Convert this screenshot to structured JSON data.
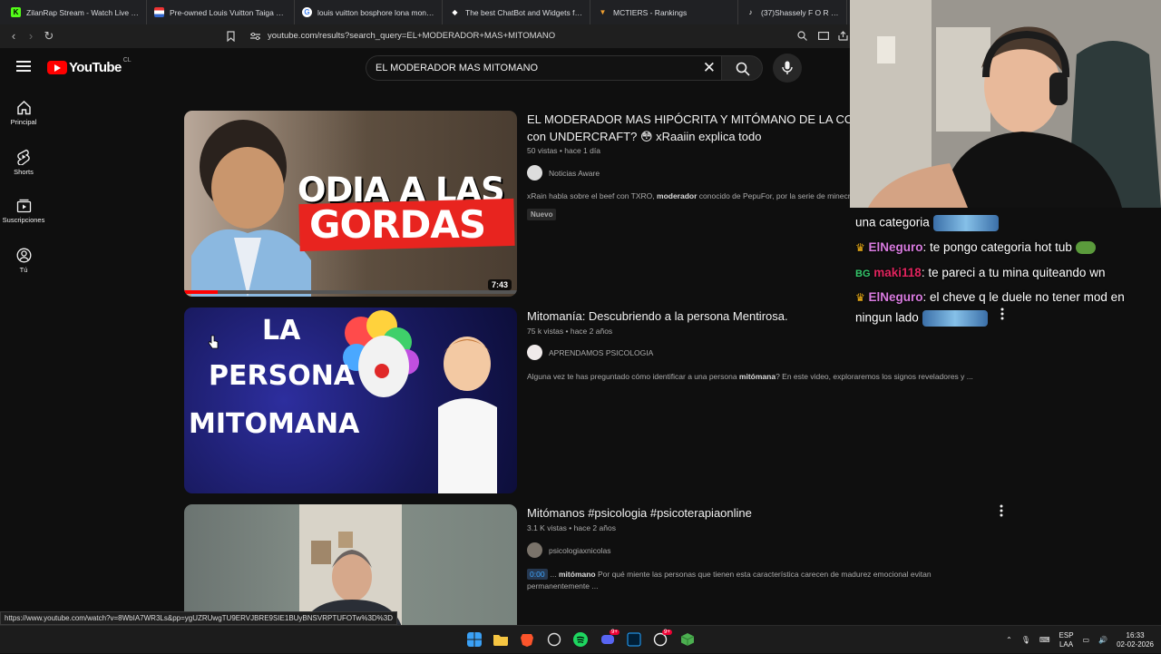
{
  "browser": {
    "tabs": [
      {
        "title": "ZilanRap Stream - Watch Live on Kick",
        "icon": "kick-icon",
        "color": "#53fc18"
      },
      {
        "title": "Pre-owned Louis Vuitton Taiga Stripe",
        "icon": "store-icon",
        "color": "#888888"
      },
      {
        "title": "louis vuitton bosphore lona monogram",
        "icon": "google-icon",
        "color": "#ffffff"
      },
      {
        "title": "The best ChatBot and Widgets for Kick",
        "icon": "chatbot-icon",
        "color": "#ffffff"
      },
      {
        "title": "MCTIERS - Rankings",
        "icon": "mctiers-icon",
        "color": "#f0a030"
      },
      {
        "title": "(37)Shassely F O R E V E R @",
        "icon": "tiktok-icon",
        "color": "#ffffff"
      }
    ],
    "url": "youtube.com/results?search_query=EL+MODERADOR+MAS+MITOMANO",
    "status_url": "https://www.youtube.com/watch?v=8WbIA7WR3Ls&pp=ygUZRUwgTU9ERVJBRE9SIE1BUyBNSVRPTUFOTw%3D%3D"
  },
  "youtube": {
    "logo_text": "YouTube",
    "country_code": "CL",
    "search_query": "EL MODERADOR MAS MITOMANO",
    "sidebar": [
      {
        "label": "Principal",
        "icon": "home-icon"
      },
      {
        "label": "Shorts",
        "icon": "shorts-icon"
      },
      {
        "label": "Suscripciones",
        "icon": "subscriptions-icon"
      },
      {
        "label": "Tú",
        "icon": "user-icon"
      }
    ],
    "results": [
      {
        "title_line1": "EL MODERADOR MAS HIPÓCRITA Y MITÓMANO DE LA COMU",
        "title_line2": "con UNDERCRAFT? 😳 xRaaiin explica todo",
        "meta": "50 vistas • hace 1 día",
        "channel": "Noticias Aware",
        "description_pre": "xRain habla sobre el beef con TXRO, ",
        "description_bold": "moderador",
        "description_post": " conocido de PepuFor, por la serie de minecr",
        "badge": "Nuevo",
        "duration": "7:43",
        "thumb_line1": "ODIA A LAS",
        "thumb_line2": "GORDAS"
      },
      {
        "title": "Mitomanía: Descubriendo a la persona Mentirosa.",
        "meta": "75 k vistas • hace 2 años",
        "channel": "APRENDAMOS PSICOLOGIA",
        "description_pre": "Alguna vez te has preguntado cómo identificar a una persona ",
        "description_bold": "mitómana",
        "description_post": "? En este video, exploraremos los signos reveladores y ...",
        "thumb_line1": "LA",
        "thumb_line2": "PERSONA",
        "thumb_line3": "MITOMANA"
      },
      {
        "title": "Mitómanos #psicologia #psicoterapiaonline",
        "meta": "3.1 K vistas • hace 2 años",
        "channel": "psicologiaxnicolas",
        "timestamp": "0:00",
        "description_pre": "... ",
        "description_bold": "mitómano",
        "description_post": " Por qué miente las personas que tienen esta característica carecen de madurez emocional evitan",
        "description_line2": "permanentemente ..."
      }
    ]
  },
  "chat": [
    {
      "user": "",
      "text": "una categoria",
      "crown": false,
      "emote": true
    },
    {
      "user": "ElNeguro",
      "text": ": te pongo categoria hot tub",
      "crown": true,
      "color": "#d97be0"
    },
    {
      "user": "maki118",
      "text": ": te pareci a tu mina quiteando wn",
      "crown": false,
      "color": "#e0245e",
      "badge": "BG"
    },
    {
      "user": "ElNeguro",
      "text": ": el cheve q le duele no tener mod en",
      "crown": true,
      "color": "#d97be0"
    },
    {
      "user": "",
      "text": "ningun lado",
      "crown": false,
      "emote": true
    }
  ],
  "taskbar": {
    "lang_top": "ESP",
    "lang_bottom": "LAA",
    "time": "16:33",
    "date": "02-02-2026",
    "discord_badge": "9+",
    "notif_badge": "9+"
  }
}
